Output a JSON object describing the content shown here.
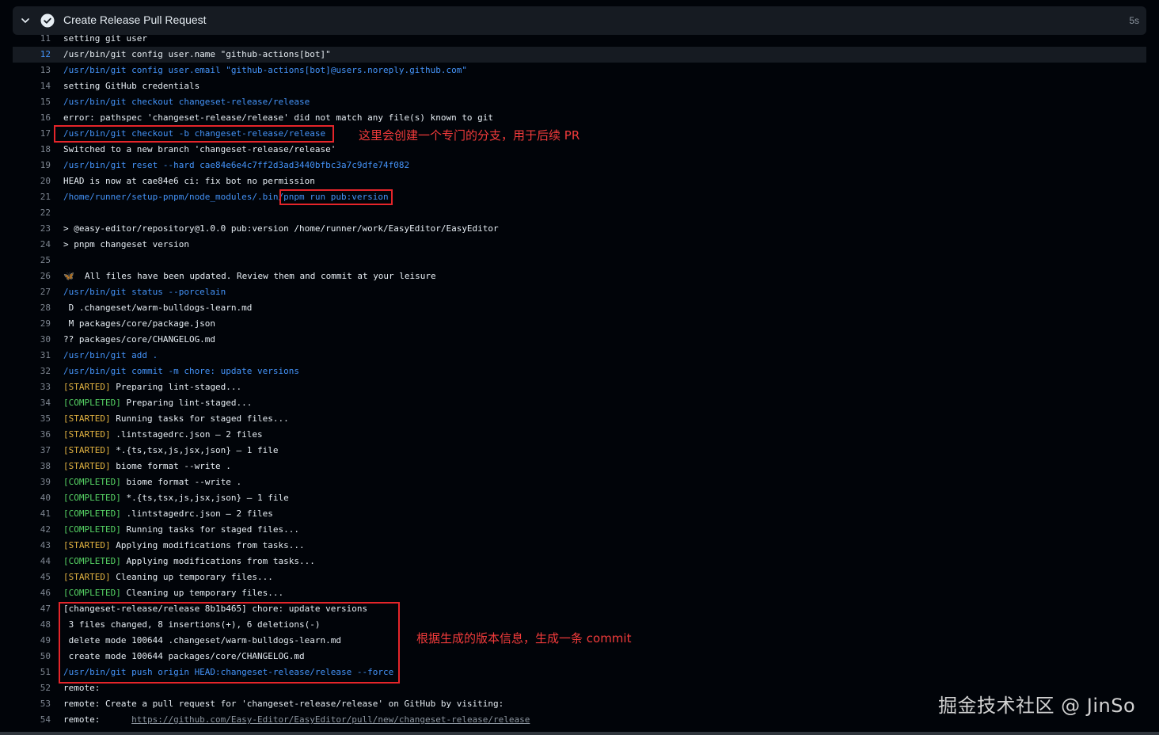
{
  "step": {
    "title": "Create Release Pull Request",
    "duration": "5s"
  },
  "log": {
    "l11": {
      "n": "11",
      "text": "setting git user"
    },
    "l12": {
      "n": "12",
      "text": "/usr/bin/git config user.name \"github-actions[bot]\""
    },
    "l13": {
      "n": "13",
      "text": "/usr/bin/git config user.email \"github-actions[bot]@users.noreply.github.com\""
    },
    "l14": {
      "n": "14",
      "text": "setting GitHub credentials"
    },
    "l15": {
      "n": "15",
      "text": "/usr/bin/git checkout changeset-release/release"
    },
    "l16": {
      "n": "16",
      "text": "error: pathspec 'changeset-release/release' did not match any file(s) known to git"
    },
    "l17": {
      "n": "17",
      "text": "/usr/bin/git checkout -b changeset-release/release"
    },
    "l18": {
      "n": "18",
      "text": "Switched to a new branch 'changeset-release/release'"
    },
    "l19": {
      "n": "19",
      "text": "/usr/bin/git reset --hard cae84e6e4c7ff2d3ad3440bfbc3a7c9dfe74f082"
    },
    "l20": {
      "n": "20",
      "text": "HEAD is now at cae84e6 ci: fix bot no permission"
    },
    "l21": {
      "n": "21",
      "a": "/home/runner/setup-pnpm/node_modules/.bin/",
      "b": "pnpm run pub:version"
    },
    "l22": {
      "n": "22",
      "text": ""
    },
    "l23": {
      "n": "23",
      "text": "> @easy-editor/repository@1.0.0 pub:version /home/runner/work/EasyEditor/EasyEditor"
    },
    "l24": {
      "n": "24",
      "text": "> pnpm changeset version"
    },
    "l25": {
      "n": "25",
      "text": ""
    },
    "l26": {
      "n": "26",
      "emoji": "🦋",
      "text": "  All files have been updated. Review them and commit at your leisure"
    },
    "l27": {
      "n": "27",
      "text": "/usr/bin/git status --porcelain"
    },
    "l28": {
      "n": "28",
      "text": " D .changeset/warm-bulldogs-learn.md"
    },
    "l29": {
      "n": "29",
      "text": " M packages/core/package.json"
    },
    "l30": {
      "n": "30",
      "text": "?? packages/core/CHANGELOG.md"
    },
    "l31": {
      "n": "31",
      "text": "/usr/bin/git add ."
    },
    "l32": {
      "n": "32",
      "text": "/usr/bin/git commit -m chore: update versions"
    },
    "l33": {
      "n": "33",
      "tag": "[STARTED]",
      "text": " Preparing lint-staged..."
    },
    "l34": {
      "n": "34",
      "tag": "[COMPLETED]",
      "text": " Preparing lint-staged..."
    },
    "l35": {
      "n": "35",
      "tag": "[STARTED]",
      "text": " Running tasks for staged files..."
    },
    "l36": {
      "n": "36",
      "tag": "[STARTED]",
      "text": " .lintstagedrc.json — 2 files"
    },
    "l37": {
      "n": "37",
      "tag": "[STARTED]",
      "text": " *.{ts,tsx,js,jsx,json} — 1 file"
    },
    "l38": {
      "n": "38",
      "tag": "[STARTED]",
      "text": " biome format --write ."
    },
    "l39": {
      "n": "39",
      "tag": "[COMPLETED]",
      "text": " biome format --write ."
    },
    "l40": {
      "n": "40",
      "tag": "[COMPLETED]",
      "text": " *.{ts,tsx,js,jsx,json} — 1 file"
    },
    "l41": {
      "n": "41",
      "tag": "[COMPLETED]",
      "text": " .lintstagedrc.json — 2 files"
    },
    "l42": {
      "n": "42",
      "tag": "[COMPLETED]",
      "text": " Running tasks for staged files..."
    },
    "l43": {
      "n": "43",
      "tag": "[STARTED]",
      "text": " Applying modifications from tasks..."
    },
    "l44": {
      "n": "44",
      "tag": "[COMPLETED]",
      "text": " Applying modifications from tasks..."
    },
    "l45": {
      "n": "45",
      "tag": "[STARTED]",
      "text": " Cleaning up temporary files..."
    },
    "l46": {
      "n": "46",
      "tag": "[COMPLETED]",
      "text": " Cleaning up temporary files..."
    },
    "l47": {
      "n": "47",
      "text": "[changeset-release/release 8b1b465] chore: update versions"
    },
    "l48": {
      "n": "48",
      "text": " 3 files changed, 8 insertions(+), 6 deletions(-)"
    },
    "l49": {
      "n": "49",
      "text": " delete mode 100644 .changeset/warm-bulldogs-learn.md"
    },
    "l50": {
      "n": "50",
      "text": " create mode 100644 packages/core/CHANGELOG.md"
    },
    "l51": {
      "n": "51",
      "text": "/usr/bin/git push origin HEAD:changeset-release/release --force"
    },
    "l52": {
      "n": "52",
      "text": "remote:"
    },
    "l53": {
      "n": "53",
      "text": "remote: Create a pull request for 'changeset-release/release' on GitHub by visiting:"
    },
    "l54": {
      "n": "54",
      "text": "remote:      ",
      "link": "https://github.com/Easy-Editor/EasyEditor/pull/new/changeset-release/release"
    }
  },
  "annotations": {
    "branch_note": "这里会创建一个专门的分支，用于后续 PR",
    "commit_note": "根据生成的版本信息，生成一条 commit"
  },
  "watermark": "掘金技术社区 @ JinSo",
  "colors": {
    "background": "#010409",
    "header_bg": "#161b22",
    "command_blue": "#4493f8",
    "started_yellow": "#e3b341",
    "completed_green": "#56d364",
    "annotation_red": "#e5252a"
  }
}
